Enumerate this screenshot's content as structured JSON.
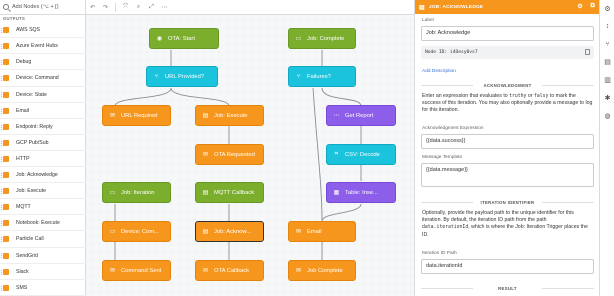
{
  "palette": {
    "search_placeholder": "Add Nodes (⌥ + [)",
    "section": "OUTPUTS",
    "items": [
      {
        "label": "AWS SQS",
        "color": "#f7961d"
      },
      {
        "label": "Azure Event Hubs",
        "color": "#f7961d"
      },
      {
        "label": "Debug",
        "color": "#f7961d"
      },
      {
        "label": "Device: Command",
        "color": "#f7961d"
      },
      {
        "label": "Device: State",
        "color": "#f7961d"
      },
      {
        "label": "Email",
        "color": "#f7961d"
      },
      {
        "label": "Endpoint: Reply",
        "color": "#f7961d"
      },
      {
        "label": "GCP Pub/Sub",
        "color": "#f7961d"
      },
      {
        "label": "HTTP",
        "color": "#f7961d"
      },
      {
        "label": "Job: Acknowledge",
        "color": "#f7961d"
      },
      {
        "label": "Job: Execute",
        "color": "#f7961d"
      },
      {
        "label": "MQTT",
        "color": "#f7961d"
      },
      {
        "label": "Notebook: Execute",
        "color": "#f7961d"
      },
      {
        "label": "Particle Call",
        "color": "#f7961d"
      },
      {
        "label": "SendGrid",
        "color": "#f7961d"
      },
      {
        "label": "Slack",
        "color": "#f7961d"
      },
      {
        "label": "SMS",
        "color": "#f7961d"
      }
    ]
  },
  "toolbar": {
    "undo": "↶",
    "redo": "↷",
    "select": "⤧",
    "zoom": "⌕",
    "fit": "⤢",
    "more": "⋯"
  },
  "nodes": {
    "ota_start": "OTA: Start",
    "url_provided": "URL Provided?",
    "url_required": "URL Required",
    "job_execute": "Job: Execute",
    "ota_requested": "OTA Requested",
    "job_iteration": "Job: Iteration",
    "device_com": "Device: Com...",
    "command_sent": "Command Sent",
    "mqtt_callback": "MQTT Callback",
    "job_acknow": "Job: Acknow...",
    "ota_callback": "OTA Callback",
    "job_complete_trigger": "Job: Complete",
    "failures": "Failures?",
    "get_report": "Get Report",
    "csv_decode": "CSV: Decode",
    "table_insert": "Table: Inse...",
    "email": "Email",
    "job_complete_out": "Job Complete"
  },
  "panel": {
    "title": "JOB: ACKNOWLEDGE",
    "label_label": "Label",
    "label_value": "Job: Acknowledge",
    "node_id_prefix": "Node ID:",
    "node_id": "i4Oesy0vs7",
    "add_description": "Add Description",
    "section_ack": "ACKNOWLEDGMENT",
    "ack_text_1": "Enter an expression that evaluates to",
    "ack_code_truthy": "truthy",
    "ack_text_or": "or",
    "ack_code_falsy": "falsy",
    "ack_text_2": "to mark the success of this iteration. You may also optionally provide a message to log for this iteration.",
    "ack_expr_label": "Acknowledgment Expression",
    "ack_expr_value": "{{data.success}}",
    "msg_template_label": "Message Template",
    "msg_template_value": "{{data.message}}",
    "section_iter": "ITERATION IDENTIFIER",
    "iter_text_1": "Optionally, provide the payload path to the unique identifier for this iteration. By default, the iteration ID path from the path",
    "iter_code": "data.iterationId",
    "iter_text_2": ", which is where the Job: Iteration Trigger places the ID.",
    "iter_path_label": "Iteration ID Path",
    "iter_path_value": "data.iterationId",
    "section_result": "RESULT"
  },
  "colors": {
    "trigger": "#7cae2e",
    "logic": "#1cc3dc",
    "output": "#f7961d",
    "data": "#8d5ee9"
  }
}
